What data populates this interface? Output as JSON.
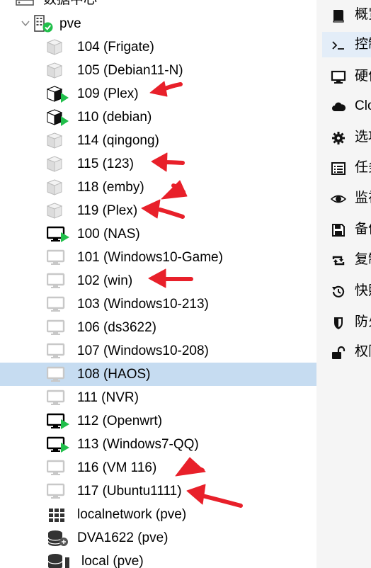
{
  "tree": {
    "datacenter_label": "数据中心",
    "node_label": "pve",
    "items": [
      {
        "label": "104 (Frigate)",
        "kind": "ct",
        "running": false,
        "selected": false
      },
      {
        "label": "105 (Debian11-N)",
        "kind": "ct",
        "running": false,
        "selected": false
      },
      {
        "label": "109 (Plex)",
        "kind": "ct",
        "running": true,
        "selected": false
      },
      {
        "label": "110 (debian)",
        "kind": "ct",
        "running": true,
        "selected": false
      },
      {
        "label": "114 (qingong)",
        "kind": "ct",
        "running": false,
        "selected": false
      },
      {
        "label": "115 (123)",
        "kind": "ct",
        "running": false,
        "selected": false
      },
      {
        "label": "118 (emby)",
        "kind": "ct",
        "running": false,
        "selected": false
      },
      {
        "label": "119 (Plex)",
        "kind": "ct",
        "running": false,
        "selected": false
      },
      {
        "label": "100 (NAS)",
        "kind": "vm",
        "running": true,
        "selected": false
      },
      {
        "label": "101 (Windows10-Game)",
        "kind": "vm",
        "running": false,
        "selected": false
      },
      {
        "label": "102 (win)",
        "kind": "vm",
        "running": false,
        "selected": false
      },
      {
        "label": "103 (Windows10-213)",
        "kind": "vm",
        "running": false,
        "selected": false
      },
      {
        "label": "106 (ds3622)",
        "kind": "vm",
        "running": false,
        "selected": false
      },
      {
        "label": "107 (Windows10-208)",
        "kind": "vm",
        "running": false,
        "selected": false
      },
      {
        "label": "108 (HAOS)",
        "kind": "vm",
        "running": false,
        "selected": true
      },
      {
        "label": "111 (NVR)",
        "kind": "vm",
        "running": false,
        "selected": false
      },
      {
        "label": "112 (Openwrt)",
        "kind": "vm",
        "running": true,
        "selected": false
      },
      {
        "label": "113 (Windows7-QQ)",
        "kind": "vm",
        "running": true,
        "selected": false
      },
      {
        "label": "116 (VM 116)",
        "kind": "vm",
        "running": false,
        "selected": false
      },
      {
        "label": "117 (Ubuntu1111)",
        "kind": "vm",
        "running": false,
        "selected": false
      },
      {
        "label": "localnetwork (pve)",
        "kind": "network",
        "running": false,
        "selected": false
      },
      {
        "label": "DVA1622 (pve)",
        "kind": "storage",
        "running": false,
        "selected": false
      },
      {
        "label": "local (pve)",
        "kind": "storage-local",
        "running": false,
        "selected": false
      }
    ]
  },
  "side_menu": {
    "items": [
      {
        "label": "概览",
        "icon": "book-icon",
        "active": false
      },
      {
        "label": "控制台",
        "icon": "terminal-icon",
        "active": true
      },
      {
        "label": "硬件",
        "icon": "monitor-icon",
        "active": false
      },
      {
        "label": "Cloud-Init",
        "icon": "cloud-icon",
        "active": false
      },
      {
        "label": "选项",
        "icon": "gear-icon",
        "active": false
      },
      {
        "label": "任务历史",
        "icon": "list-icon",
        "active": false
      },
      {
        "label": "监视器",
        "icon": "eye-icon",
        "active": false
      },
      {
        "label": "备份",
        "icon": "floppy-icon",
        "active": false
      },
      {
        "label": "复制",
        "icon": "retweet-icon",
        "active": false
      },
      {
        "label": "快照",
        "icon": "history-icon",
        "active": false
      },
      {
        "label": "防火墙",
        "icon": "shield-icon",
        "active": false
      },
      {
        "label": "权限",
        "icon": "unlock-icon",
        "active": false
      }
    ]
  },
  "colors": {
    "selected_row": "#c6dcf1",
    "running_green": "#21bf4b",
    "arrow_red": "#e8202a",
    "stopped_gray": "#c8c8c8",
    "side_panel": "#f5f5f5"
  }
}
